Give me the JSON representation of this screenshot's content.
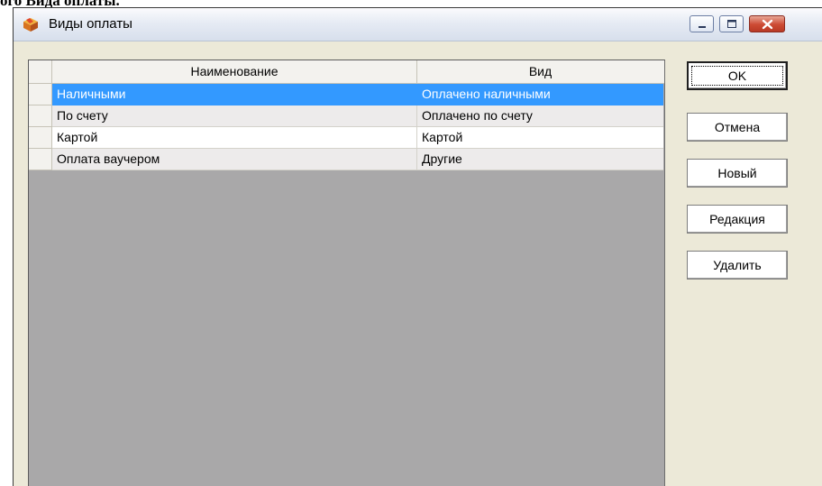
{
  "page_caption": "ого Вида оплаты.",
  "window": {
    "title": "Виды оплаты",
    "title_icon": "box-icon",
    "controls": [
      "minimize-icon",
      "maximize-icon",
      "close-icon"
    ]
  },
  "grid": {
    "columns": [
      "Наименование",
      "Вид"
    ],
    "rows": [
      {
        "name": "Наличными",
        "kind": "Оплачено наличными",
        "state": "selected"
      },
      {
        "name": "По счету",
        "kind": "Оплачено по счету",
        "state": "shaded"
      },
      {
        "name": "Картой",
        "kind": "Картой",
        "state": "plain"
      },
      {
        "name": "Оплата ваучером",
        "kind": "Другие",
        "state": "shaded"
      }
    ]
  },
  "buttons": {
    "ok": "OK",
    "cancel": "Отмена",
    "new": "Новый",
    "edit": "Редакция",
    "delete": "Удалить"
  },
  "colors": {
    "selection": "#3399ff",
    "grid_background": "#a9a8a9",
    "dialog_background": "#ece9d8",
    "close_button": "#cc4a33"
  }
}
